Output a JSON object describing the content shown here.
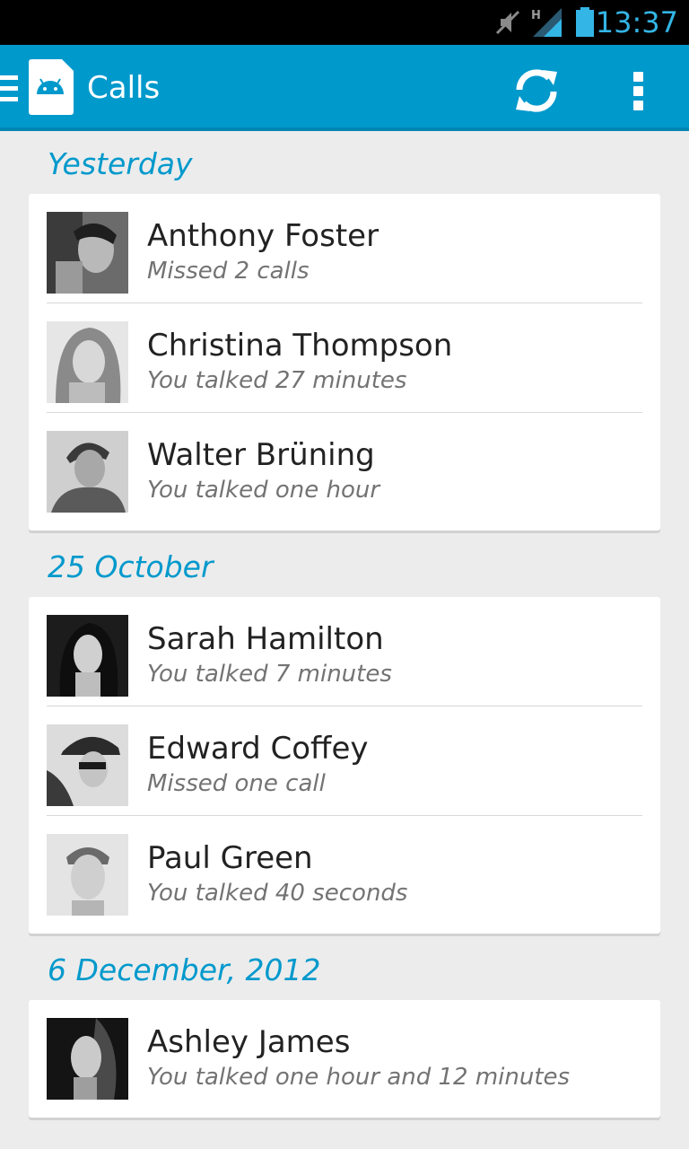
{
  "status_bar": {
    "time": "13:37",
    "network": "H",
    "icons": [
      "mute-icon",
      "signal-icon",
      "battery-icon"
    ]
  },
  "action_bar": {
    "title": "Calls",
    "icons": [
      "drawer-icon",
      "android-app-icon",
      "refresh-icon",
      "overflow-menu-icon"
    ]
  },
  "colors": {
    "accent": "#0099cc",
    "status_time": "#33b5e5",
    "background": "#ececec",
    "name_text": "#222222",
    "detail_text": "#737373"
  },
  "sections": [
    {
      "header": "Yesterday",
      "calls": [
        {
          "name": "Anthony Foster",
          "detail": "Missed 2 calls"
        },
        {
          "name": "Christina Thompson",
          "detail": "You talked 27 minutes"
        },
        {
          "name": "Walter Brüning",
          "detail": "You talked one hour"
        }
      ]
    },
    {
      "header": "25 October",
      "calls": [
        {
          "name": "Sarah Hamilton",
          "detail": "You talked 7 minutes"
        },
        {
          "name": "Edward Coffey",
          "detail": "Missed one call"
        },
        {
          "name": "Paul Green",
          "detail": "You talked 40 seconds"
        }
      ]
    },
    {
      "header": "6 December, 2012",
      "calls": [
        {
          "name": "Ashley James",
          "detail": "You talked one hour and 12 minutes"
        }
      ]
    }
  ]
}
